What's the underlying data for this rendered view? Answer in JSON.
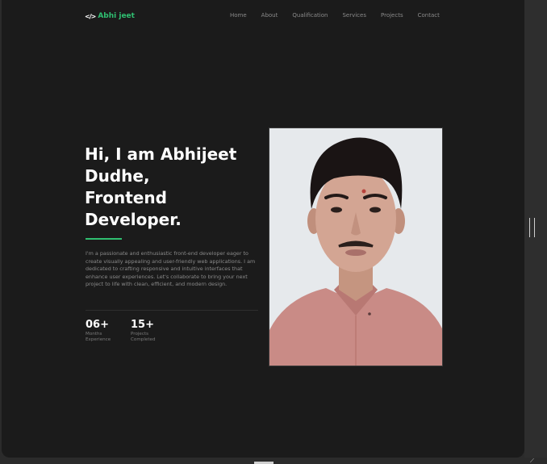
{
  "nav": {
    "logo_icon": "</>",
    "logo_text": "Abhi jeet",
    "menu": [
      "Home",
      "About",
      "Qualification",
      "Services",
      "Projects",
      "Contact"
    ]
  },
  "hero": {
    "title_lines": [
      "Hi, I am Abhijeet",
      "Dudhe,",
      "Frontend",
      "Developer."
    ],
    "description": "I'm a passionate and enthusiastic front-end developer eager to create visually appealing and user-friendly web applications. I am dedicated to crafting responsive and intuitive interfaces that enhance user experiences. Let's collaborate to bring your next project to life with clean, efficient, and modern design.",
    "stats": [
      {
        "number": "06+",
        "label": "Months Experience"
      },
      {
        "number": "15+",
        "label": "Projects Completed"
      }
    ]
  },
  "colors": {
    "accent": "#2fbf71",
    "background": "#1b1b1b",
    "text": "#ffffff",
    "muted": "#8a8a8a"
  }
}
